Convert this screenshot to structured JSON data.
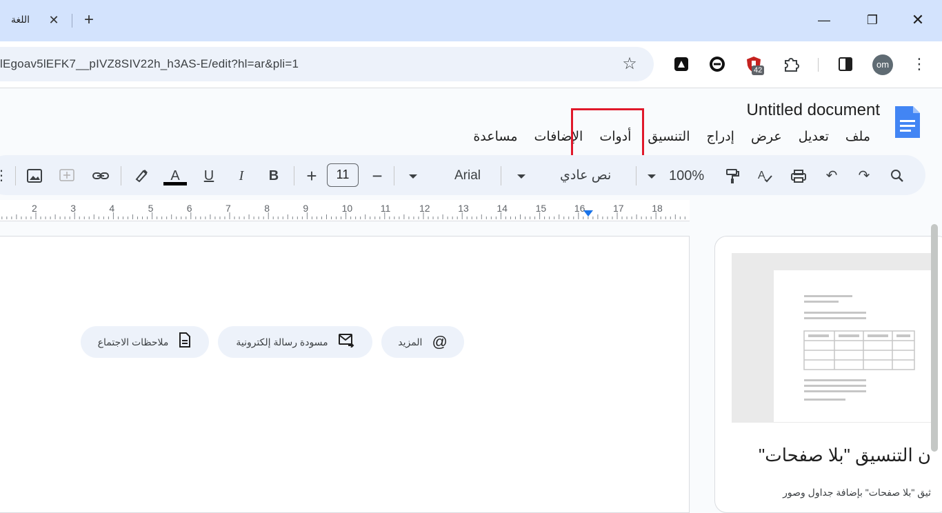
{
  "browser": {
    "tab_title": "اللغة",
    "tab_close": "✕",
    "new_tab": "+",
    "url": "lEgoav5lEFK7__pIVZ8SIV22h_h3AS-E/edit?hl=ar&pli=1",
    "extension_badge": "42",
    "avatar_initials": "om",
    "window_controls": {
      "minimize": "—",
      "restore": "❐",
      "close": "✕"
    }
  },
  "docs": {
    "title": "Untitled document",
    "menu": [
      "ملف",
      "تعديل",
      "عرض",
      "إدراج",
      "التنسيق",
      "أدوات",
      "الإضافات",
      "مساعدة"
    ],
    "highlighted_menu": "أدوات",
    "highlight_color": "#e0182a"
  },
  "toolbar": {
    "zoom": "100%",
    "style": "نص عادي",
    "font": "Arial",
    "font_size": "11",
    "bold": "B",
    "italic": "I",
    "underline": "U",
    "text_color": "A"
  },
  "ruler": {
    "numbers": [
      "2",
      "3",
      "4",
      "5",
      "6",
      "7",
      "8",
      "9",
      "10",
      "11",
      "12",
      "13",
      "14",
      "15",
      "16",
      "17",
      "18"
    ]
  },
  "chips": {
    "more": "المزيد",
    "email_draft": "مسودة رسالة إلكترونية",
    "meeting_notes": "ملاحظات الاجتماع"
  },
  "panel": {
    "title": "ن التنسيق \"بلا صفحات\"",
    "description": "ثيق \"بلا صفحات\" بإضافة جداول وصور"
  },
  "colors": {
    "tabstrip": "#d3e3fd",
    "toolbar": "#edf2fa",
    "docs_blue": "#4285f4",
    "ruler_marker": "#1a73e8"
  }
}
